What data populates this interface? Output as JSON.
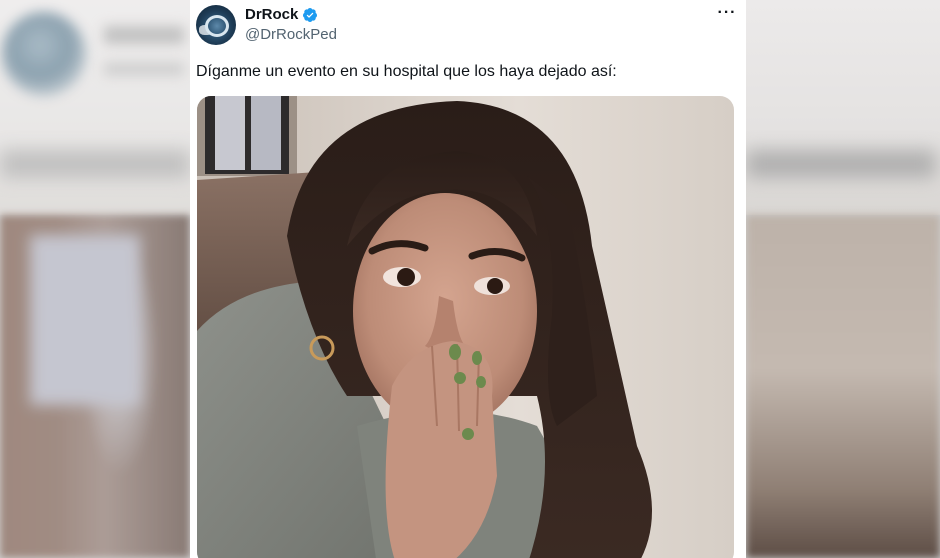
{
  "tweet": {
    "author_name": "DrRock",
    "author_handle": "@DrRockPed",
    "more_label": "···",
    "text": "Díganme un evento en su hospital que los haya dejado así:",
    "verified_icon": "verified-badge-icon",
    "media_alt": "photo"
  },
  "colors": {
    "accent": "#1d9bf0",
    "text_primary": "#0f1419",
    "text_secondary": "#536471"
  }
}
